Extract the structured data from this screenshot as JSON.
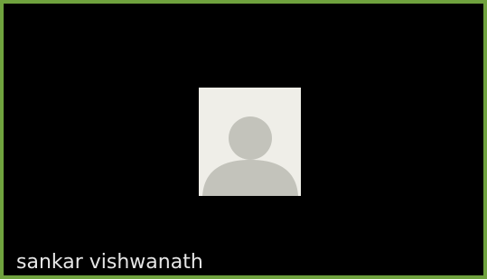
{
  "participant": {
    "name": "sankar vishwanath",
    "avatar_icon": "default-user-avatar-icon",
    "video": "off"
  },
  "colors": {
    "tile_border": "#6fa23e",
    "tile_background": "#000000",
    "avatar_background": "#efeee8",
    "avatar_silhouette": "#c3c3bb",
    "name_text": "#e6e6e6"
  }
}
